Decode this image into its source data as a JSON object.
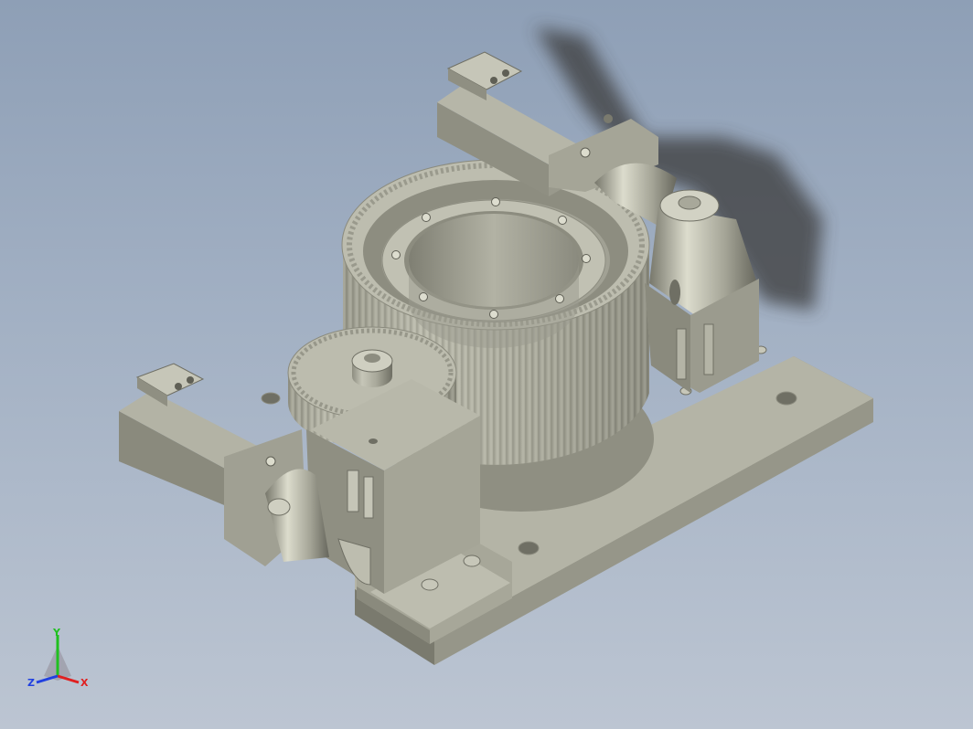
{
  "viewport": {
    "background_top": "#8e9fb6",
    "background_bottom": "#bcc5d2",
    "model_color": "#a8a89a"
  },
  "model": {
    "parts": [
      "base-plate",
      "large-ring-gear",
      "pinion-gear",
      "gearbox-housing",
      "servo-motor-front",
      "servo-motor-rear",
      "right-angle-reducer-front",
      "right-angle-reducer-rear"
    ]
  },
  "triad": {
    "x_label": "X",
    "y_label": "Y",
    "z_label": "Z",
    "x_color": "#e02020",
    "y_color": "#20c020",
    "z_color": "#2040e0"
  }
}
